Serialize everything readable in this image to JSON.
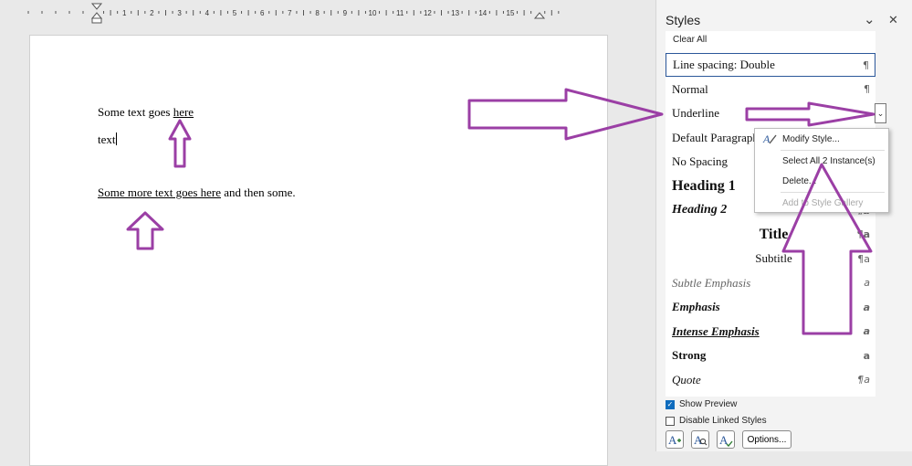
{
  "ruler": {
    "numbers": [
      "1",
      "2",
      "3",
      "4",
      "5",
      "6",
      "7",
      "8",
      "9",
      "10",
      "11",
      "12",
      "13",
      "14",
      "15"
    ]
  },
  "document": {
    "line1_prefix": "Some text goes ",
    "line1_underlined": "here",
    "line2": "text",
    "line3_underlined": "Some more text goes here",
    "line3_suffix": " and then some."
  },
  "styles_pane": {
    "title": "Styles",
    "collapse_glyph": "⌄",
    "close_glyph": "✕",
    "clear_all": "Clear All",
    "items": [
      {
        "label": "Line spacing:  Double",
        "mark": "¶"
      },
      {
        "label": "Normal",
        "mark": "¶"
      },
      {
        "label": "Underline",
        "mark": ""
      },
      {
        "label": "Default Paragraph Font",
        "mark": ""
      },
      {
        "label": "No Spacing",
        "mark": "¶"
      },
      {
        "label": "Heading 1",
        "mark": "¶a"
      },
      {
        "label": "Heading 2",
        "mark": "¶a"
      },
      {
        "label": "Title",
        "mark": "¶a"
      },
      {
        "label": "Subtitle",
        "mark": "¶a"
      },
      {
        "label": "Subtle Emphasis",
        "mark": "a"
      },
      {
        "label": "Emphasis",
        "mark": "a"
      },
      {
        "label": "Intense Emphasis",
        "mark": "a"
      },
      {
        "label": "Strong",
        "mark": "a"
      },
      {
        "label": "Quote",
        "mark": "¶a"
      }
    ],
    "dropdown_glyph": "⌄",
    "show_preview": "Show Preview",
    "show_preview_checked": true,
    "disable_linked": "Disable Linked Styles",
    "disable_linked_checked": false,
    "options_label": "Options..."
  },
  "context_menu": {
    "modify": "Modify Style...",
    "select_all": "Select All 2 Instance(s)",
    "delete": "Delete...",
    "add_gallery": "Add to Style Gallery"
  },
  "colors": {
    "accent": "#2b579a",
    "arrow": "#9b3fa5",
    "checkbox": "#0f6cbd"
  },
  "icons": {
    "modify_style": "modify-style-icon",
    "new_style": "new-style-icon",
    "style_inspector": "style-inspector-icon",
    "manage_styles": "manage-styles-icon"
  }
}
